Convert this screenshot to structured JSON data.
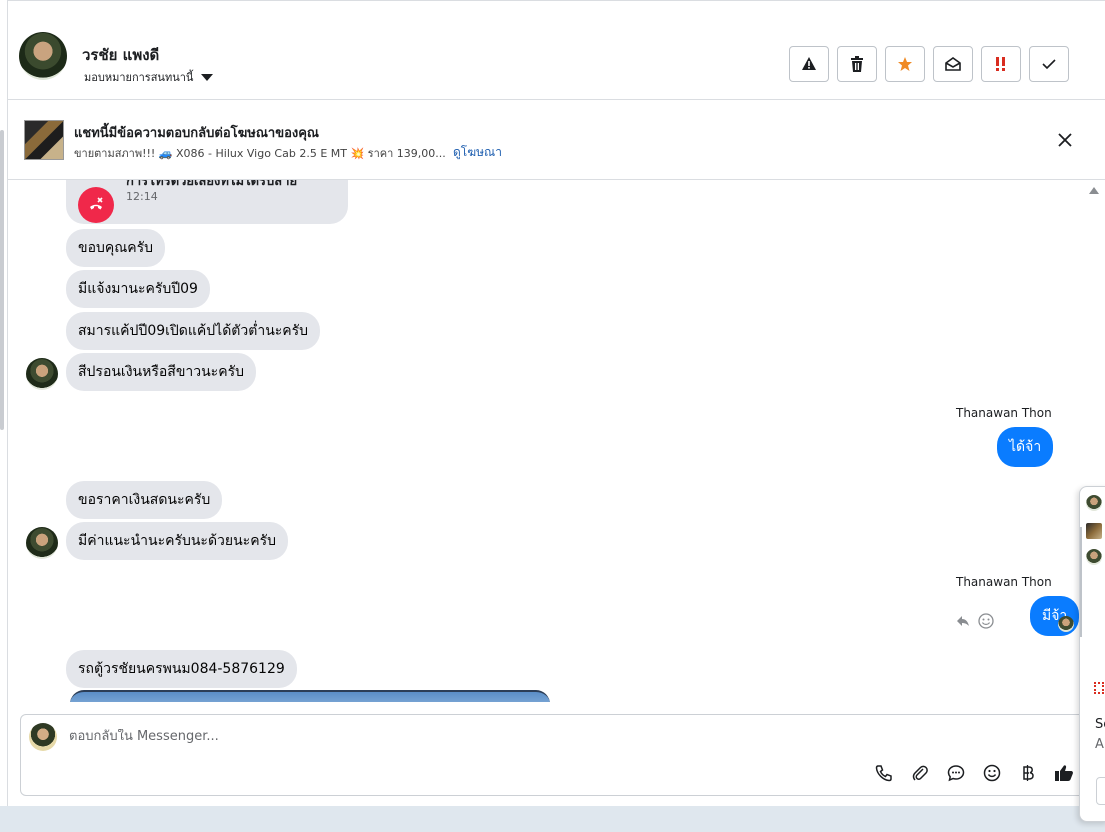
{
  "header": {
    "contact_name": "วรชัย แพงดี",
    "assign_label": "มอบหมายการสนทนานี้",
    "actions": [
      "warning-icon",
      "trash-icon",
      "star-icon",
      "mark-unread-icon",
      "priority-icon",
      "done-icon"
    ]
  },
  "ad_banner": {
    "title": "แชทนี้มีข้อความตอบกลับต่อโฆษณาของคุณ",
    "description": "ขายตามสภาพ!!! 🚙 X086 - Hilux Vigo Cab 2.5 E MT 💥 ราคา 139,00...",
    "link_label": "ดูโฆษณา"
  },
  "messages": {
    "missed_call_title": "การโทรด้วยเสียงที่ไม่ได้รับสาย",
    "missed_call_time": "12:14",
    "m1": "ขอบคุณครับ",
    "m2": "มีแจ้งมานะครับปี09",
    "m3": "สมารแค้ปปี09เปิดแค้ปได้ตัวต่ำนะครับ",
    "m4": "สีปรอนเงินหรือสีขาวนะครับ",
    "sender1": "Thanawan Thon",
    "o1": "ได้จ้า",
    "m5": "ขอราคาเงินสดนะครับ",
    "m6": "มีค่าแนะนำนะครับนะด้วยนะครับ",
    "sender2": "Thanawan Thon",
    "o2": "มีจ้า",
    "m7": "รถตู้วรชัยนครพนม084-5876129"
  },
  "composer": {
    "placeholder": "ตอบกลับใน Messenger...",
    "tools": [
      "phone-icon",
      "attachment-icon",
      "saved-reply-icon",
      "emoji-icon",
      "baht-icon",
      "like-icon"
    ]
  },
  "side_peek": {
    "text1": "Sc",
    "text2": "A"
  },
  "colors": {
    "outgoing_bubble": "#0a7cff",
    "incoming_bubble": "#e4e6eb",
    "missed_call": "#f0284a",
    "link": "#1f5fb0",
    "star": "#f08a24",
    "priority": "#d92d20"
  }
}
